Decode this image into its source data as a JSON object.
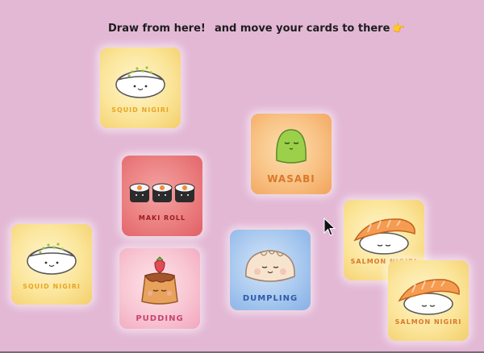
{
  "instructions": {
    "draw": "Draw from here!",
    "move": "and move your cards to there",
    "move_emoji": "👉"
  },
  "cards": {
    "deck_squid": {
      "label": "Squid Nigiri",
      "color": "#e8a623"
    },
    "wasabi": {
      "label": "Wasabi",
      "color": "#d9782a"
    },
    "maki": {
      "label": "Maki Roll",
      "color": "#9b1c22"
    },
    "squid2": {
      "label": "Squid Nigiri",
      "color": "#e8a623"
    },
    "pudding": {
      "label": "Pudding",
      "color": "#c94470"
    },
    "dumpling": {
      "label": "Dumpling",
      "color": "#2d5ba8"
    },
    "salmon1": {
      "label": "Salmon Nigiri",
      "color": "#d9782a"
    },
    "salmon2": {
      "label": "Salmon Nigiri",
      "color": "#d9782a"
    }
  },
  "icons": {
    "cursor": "arrow-pointer-icon"
  }
}
